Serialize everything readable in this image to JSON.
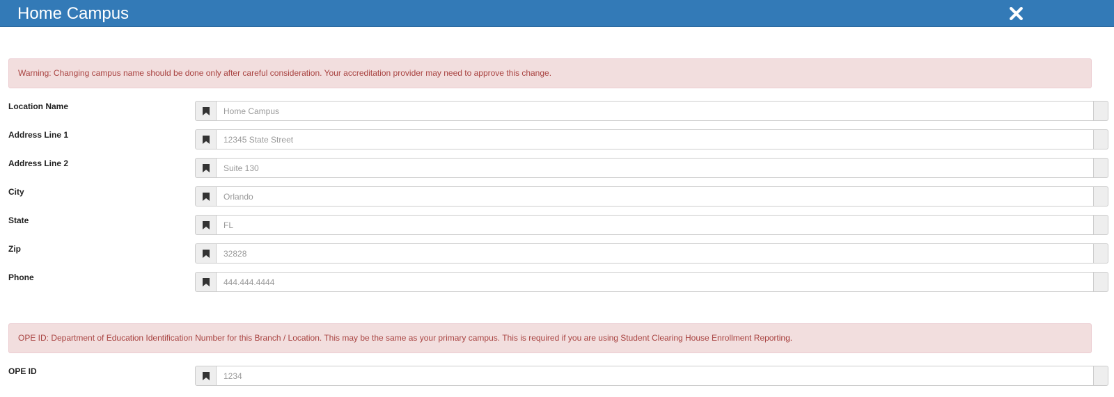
{
  "header": {
    "title": "Home Campus",
    "close_icon": "close-icon"
  },
  "warning": {
    "text": "Warning: Changing campus name should be done only after careful consideration. Your accreditation provider may need to approve this change."
  },
  "fields": [
    {
      "label": "Location Name",
      "placeholder": "Home Campus",
      "value": "",
      "icon": "bookmark-icon"
    },
    {
      "label": "Address Line 1",
      "placeholder": "12345 State Street",
      "value": "",
      "icon": "bookmark-icon"
    },
    {
      "label": "Address Line 2",
      "placeholder": "Suite 130",
      "value": "",
      "icon": "bookmark-icon"
    },
    {
      "label": "City",
      "placeholder": "Orlando",
      "value": "",
      "icon": "bookmark-icon"
    },
    {
      "label": "State",
      "placeholder": "FL",
      "value": "",
      "icon": "bookmark-icon"
    },
    {
      "label": "Zip",
      "placeholder": "32828",
      "value": "",
      "icon": "bookmark-icon"
    },
    {
      "label": "Phone",
      "placeholder": "444.444.4444",
      "value": "",
      "icon": "bookmark-icon"
    }
  ],
  "ope_info": {
    "text": "OPE ID: Department of Education Identification Number for this Branch / Location. This may be the same as your primary campus. This is required if you are using Student Clearing House Enrollment Reporting."
  },
  "ope_field": {
    "label": "OPE ID",
    "placeholder": "1234",
    "value": "",
    "icon": "bookmark-icon"
  },
  "colors": {
    "header": "#337ab7",
    "alert_bg": "#f2dede",
    "alert_text": "#a94442"
  }
}
